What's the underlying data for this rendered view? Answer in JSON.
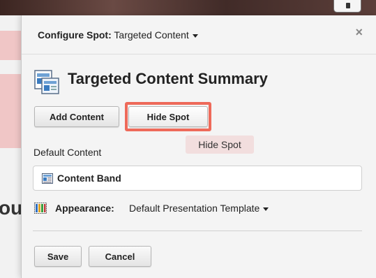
{
  "dialog": {
    "title_label": "Configure Spot:",
    "title_value": "Targeted Content",
    "close_glyph": "×",
    "summary_title": "Targeted Content Summary"
  },
  "buttons": {
    "add_content": "Add Content",
    "hide_spot": "Hide Spot",
    "save": "Save",
    "cancel": "Cancel"
  },
  "tooltip": {
    "text": "Hide Spot"
  },
  "default_content": {
    "label": "Default Content",
    "item": "Content Band"
  },
  "appearance": {
    "label": "Appearance:",
    "value": "Default Presentation Template"
  },
  "background": {
    "partial_text": "ou"
  },
  "colors": {
    "highlight": "#ee6a5a",
    "tooltip_bg": "#f2dede",
    "band": "#f0c6c6"
  },
  "icons": {
    "summary": "targeted-content-icon",
    "content": "content-band-icon",
    "appearance": "presentation-template-icon",
    "caret": "chevron-down-icon"
  }
}
